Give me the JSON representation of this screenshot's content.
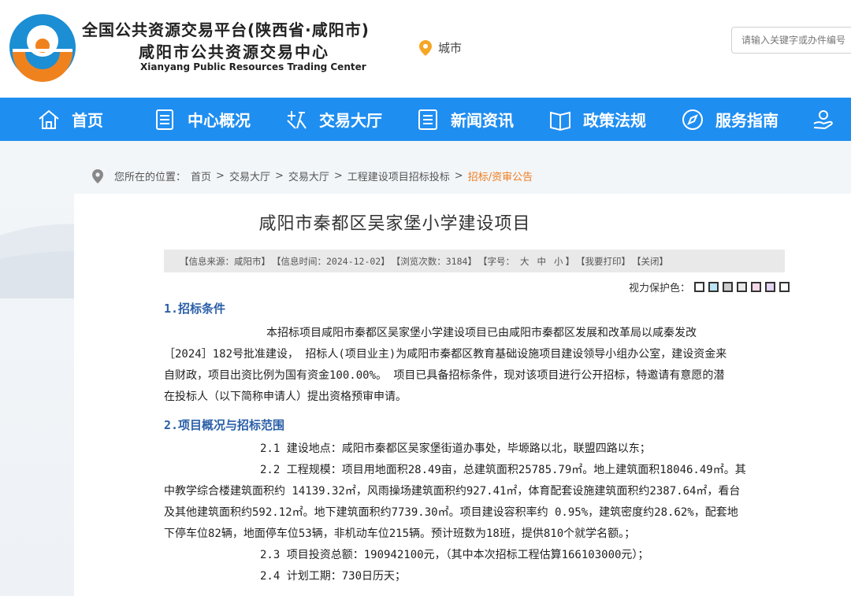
{
  "header": {
    "title": "全国公共资源交易平台(陕西省·咸阳市)",
    "subtitle": "咸阳市公共资源交易中心",
    "title_en": "Xianyang Public Resources Trading Center",
    "city_label": "城市",
    "search_placeholder": "请输入关键字或办件编号"
  },
  "nav": {
    "items": [
      {
        "label": "首页",
        "icon": "home-icon"
      },
      {
        "label": "中心概况",
        "icon": "document-icon"
      },
      {
        "label": "交易大厅",
        "icon": "trade-hall-icon"
      },
      {
        "label": "新闻资讯",
        "icon": "news-icon"
      },
      {
        "label": "政策法规",
        "icon": "book-icon"
      },
      {
        "label": "服务指南",
        "icon": "compass-icon"
      }
    ]
  },
  "breadcrumb": {
    "prefix": "您所在的位置：",
    "items": [
      "首页",
      "交易大厅",
      "交易大厅",
      "工程建设项目招标投标"
    ],
    "current": "招标/资审公告"
  },
  "article": {
    "title": "咸阳市秦都区吴家堡小学建设项目",
    "meta": {
      "source": "【信息来源：咸阳市】",
      "time": "【信息时间：2024-12-02】",
      "views": "【浏览次数：3184】",
      "font_label": "【字号：",
      "font_large": "大",
      "font_medium": "中",
      "font_small": "小",
      "font_end": "】",
      "print": "【我要打印】",
      "close": "【关闭】"
    },
    "eye_label": "视力保护色：",
    "eye_colors": [
      "#ffffff",
      "#bde4f4",
      "#cccccc",
      "#e8e8e8",
      "#f5d8e8",
      "#e3d4f2",
      "#ffffff"
    ],
    "section1_title": "1.招标条件",
    "section1_lines": [
      "本招标项目咸阳市秦都区吴家堡小学建设项目已由咸阳市秦都区发展和改革局以咸秦发改",
      "［2024］182号批准建设， 招标人(项目业主)为咸阳市秦都区教育基础设施项目建设领导小组办公室，建设资金来",
      "自财政，项目出资比例为国有资金100.00%。 项目已具备招标条件，现对该项目进行公开招标，特邀请有意愿的潜",
      "在投标人（以下简称申请人）提出资格预审申请。"
    ],
    "section2_title": "2.项目概况与招标范围",
    "section2_lines": [
      "2.1 建设地点：咸阳市秦都区吴家堡街道办事处，毕塬路以北，联盟四路以东；",
      "2.2 工程规模：项目用地面积28.49亩，总建筑面积25785.79㎡。地上建筑面积18046.49㎡。其",
      "中教学综合楼建筑面积约 14139.32㎡，风雨操场建筑面积约927.41㎡，体育配套设施建筑面积约2387.64㎡，看台",
      "及其他建筑面积约592.12㎡。地下建筑面积约7739.30㎡。项目建设容积率约 0.95%，建筑密度约28.62%，配套地",
      "下停车位82辆，地面停车位53辆，非机动车位215辆。预计班数为18班，提供810个就学名额。；",
      "2.3 项目投资总额：190942100元，（其中本次招标工程估算166103000元）；",
      "2.4 计划工期：730日历天；"
    ]
  }
}
